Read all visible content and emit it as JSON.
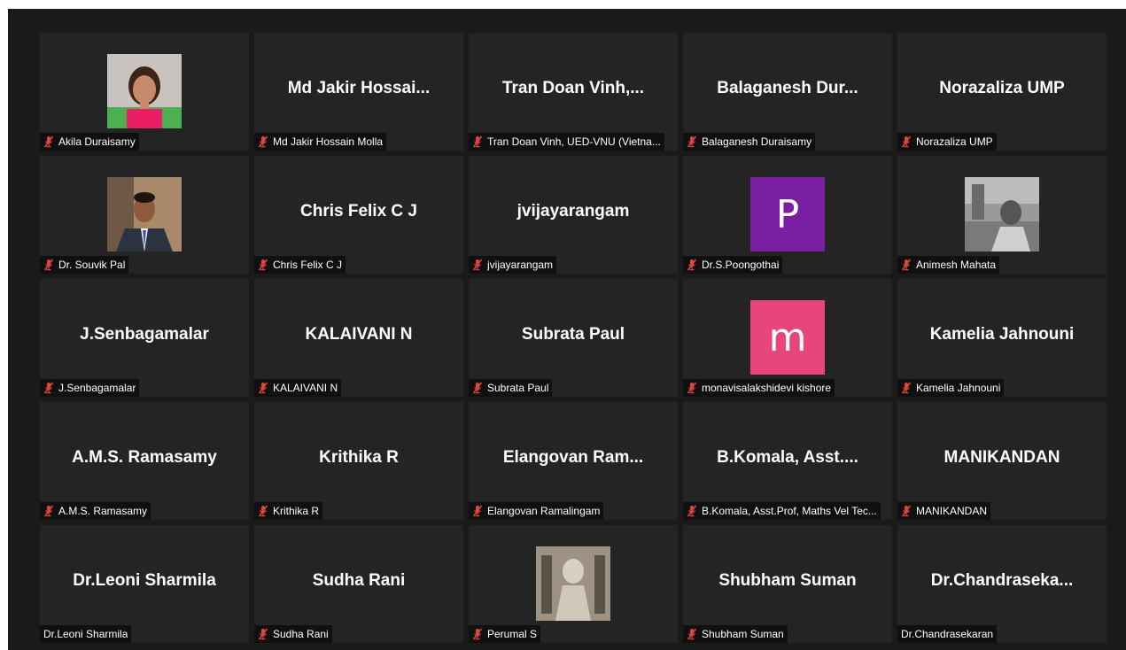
{
  "participants": [
    {
      "big_name": "",
      "tag": "Akila Duraisamy",
      "muted": true,
      "avatar_type": "photo",
      "photo": "woman-portrait"
    },
    {
      "big_name": "Md Jakir Hossai...",
      "tag": "Md Jakir Hossain Molla",
      "muted": true,
      "avatar_type": "none"
    },
    {
      "big_name": "Tran Doan Vinh,...",
      "tag": "Tran Doan Vinh, UED-VNU (Vietna...",
      "muted": true,
      "avatar_type": "none"
    },
    {
      "big_name": "Balaganesh Dur...",
      "tag": "Balaganesh Duraisamy",
      "muted": true,
      "avatar_type": "none"
    },
    {
      "big_name": "Norazaliza UMP",
      "tag": "Norazaliza UMP",
      "muted": true,
      "avatar_type": "none"
    },
    {
      "big_name": "",
      "tag": "Dr. Souvik Pal",
      "muted": true,
      "avatar_type": "photo",
      "photo": "man-suit"
    },
    {
      "big_name": "Chris Felix C J",
      "tag": "Chris Felix C J",
      "muted": true,
      "avatar_type": "none"
    },
    {
      "big_name": "jvijayarangam",
      "tag": "jvijayarangam",
      "muted": true,
      "avatar_type": "none"
    },
    {
      "big_name": "",
      "tag": "Dr.S.Poongothai",
      "muted": true,
      "avatar_type": "letter",
      "letter": "P",
      "color": "#7b1fa2"
    },
    {
      "big_name": "",
      "tag": "Animesh Mahata",
      "muted": true,
      "avatar_type": "photo",
      "photo": "grayscale"
    },
    {
      "big_name": "J.Senbagamalar",
      "tag": "J.Senbagamalar",
      "muted": true,
      "avatar_type": "none"
    },
    {
      "big_name": "KALAIVANI N",
      "tag": "KALAIVANI N",
      "muted": true,
      "avatar_type": "none"
    },
    {
      "big_name": "Subrata Paul",
      "tag": "Subrata Paul",
      "muted": true,
      "avatar_type": "none"
    },
    {
      "big_name": "",
      "tag": "monavisalakshidevi kishore",
      "muted": true,
      "avatar_type": "letter",
      "letter": "m",
      "color": "#e8457a"
    },
    {
      "big_name": "Kamelia Jahnouni",
      "tag": "Kamelia Jahnouni",
      "muted": true,
      "avatar_type": "none"
    },
    {
      "big_name": "A.M.S. Ramasamy",
      "tag": "A.M.S. Ramasamy",
      "muted": true,
      "avatar_type": "none"
    },
    {
      "big_name": "Krithika R",
      "tag": "Krithika R",
      "muted": true,
      "avatar_type": "none"
    },
    {
      "big_name": "Elangovan  Ram...",
      "tag": "Elangovan Ramalingam",
      "muted": true,
      "avatar_type": "none"
    },
    {
      "big_name": "B.Komala,   Asst....",
      "tag": "B.Komala,  Asst.Prof, Maths Vel Tec...",
      "muted": true,
      "avatar_type": "none"
    },
    {
      "big_name": "MANIKANDAN",
      "tag": "MANIKANDAN",
      "muted": true,
      "avatar_type": "none"
    },
    {
      "big_name": "Dr.Leoni Sharmila",
      "tag": "Dr.Leoni Sharmila",
      "muted": false,
      "avatar_type": "none"
    },
    {
      "big_name": "Sudha Rani",
      "tag": "Sudha Rani",
      "muted": true,
      "avatar_type": "none"
    },
    {
      "big_name": "",
      "tag": "Perumal S",
      "muted": true,
      "avatar_type": "photo",
      "photo": "sepia"
    },
    {
      "big_name": "Shubham Suman",
      "tag": "Shubham Suman",
      "muted": true,
      "avatar_type": "none"
    },
    {
      "big_name": "Dr.Chandraseka...",
      "tag": "Dr.Chandrasekaran",
      "muted": false,
      "avatar_type": "none"
    }
  ],
  "colors": {
    "tile_bg": "#242424",
    "window_bg": "#1a1a1a",
    "mute_red": "#e0463a"
  }
}
